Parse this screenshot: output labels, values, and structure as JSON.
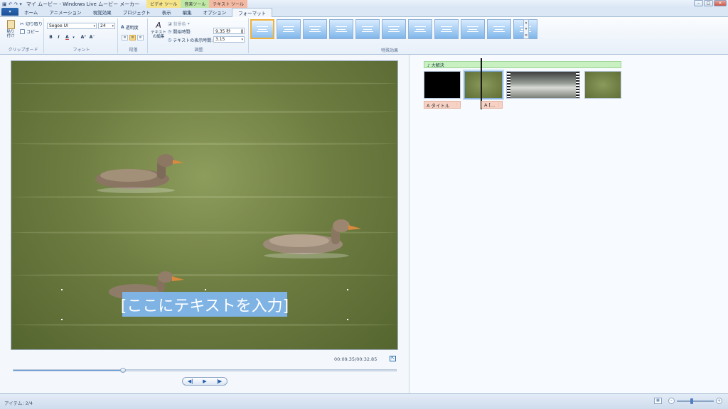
{
  "titlebar": {
    "app_title": "マイ ムービー - Windows Live ムービー メーカー",
    "context_tabs": {
      "video": "ビデオ ツール",
      "music": "音楽ツール",
      "text": "テキスト ツール"
    },
    "window_buttons": {
      "minimize": "–",
      "maximize": "□",
      "close": "✕"
    }
  },
  "tabs": {
    "file_label": "▾",
    "items": [
      "ホーム",
      "アニメーション",
      "視覚効果",
      "プロジェクト",
      "表示",
      "編集",
      "オプション",
      "フォーマット"
    ],
    "active_index": 7
  },
  "ribbon": {
    "clipboard": {
      "paste": "貼り付け",
      "cut": "切り取り",
      "copy": "コピー",
      "label": "クリップボード"
    },
    "font": {
      "family": "Segoe UI",
      "size": "24",
      "bold": "B",
      "italic": "I",
      "color": "A",
      "grow": "A⁺",
      "shrink": "A⁻",
      "label": "フォント"
    },
    "paragraph": {
      "transparency": "透明度",
      "label": "段落"
    },
    "adjust": {
      "edit_text": "テキストの編集",
      "bg_color": "背景色",
      "start_time_label": "開始時間:",
      "start_time_value": "9.35 秒",
      "duration_label": "テキストの表示時間:",
      "duration_value": "3.15",
      "label": "調整"
    },
    "effects": {
      "label": "特殊効果",
      "selected_index": 0
    }
  },
  "preview": {
    "overlay_text": "[ここにテキストを入力]",
    "timecode": "00:09.35/00:32.85",
    "seek_progress": 0.286,
    "controls": {
      "prev": "◀|",
      "play": "▶",
      "next": "|▶"
    }
  },
  "storyboard": {
    "music_label": "♪ 大解決",
    "captions": [
      {
        "label": "A タイトル"
      },
      {
        "label": "A [..."
      }
    ]
  },
  "statusbar": {
    "items_text": "アイテム: 2/4",
    "zoom_level": 0.4
  }
}
